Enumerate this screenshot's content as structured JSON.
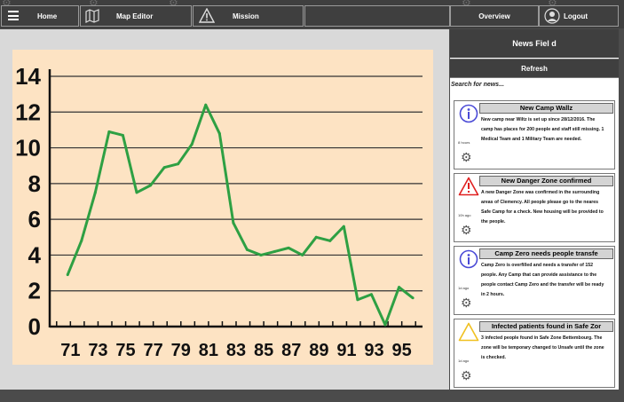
{
  "nav": {
    "menu_icon": "hamburger-icon",
    "home_label": "Home",
    "map_editor_label": "Map Editor",
    "map_icon": "map-icon",
    "mission_label": "Mission",
    "mission_icon": "warning-triangle-icon",
    "overview_label": "Overview",
    "logout_label": "Logout",
    "user_icon": "user-icon"
  },
  "sidebar": {
    "title": "News Fiel d",
    "refresh_label": "Refresh",
    "search_placeholder": "Search for news...",
    "items": [
      {
        "title": "New Camp Wallz",
        "icon": "info-icon",
        "icon_color": "#4a4ad6",
        "time": "8 hours",
        "body": "New camp near Wiltz is set up since 28/12/2016. The camp has places for 200 people and staff still missing. 1 Medical Team and 1 Military Team are needed."
      },
      {
        "title": "New Danger Zone confirmed",
        "icon": "warning-icon",
        "icon_color": "#e02020",
        "time": "10h ago",
        "body": "A new Danger Zone was confirmed in the surrounding areas of Clemency. All people please go to the neares Safe Camp for a check. New housing will be provided to the people."
      },
      {
        "title": "Camp Zero needs people transfe",
        "icon": "info-icon",
        "icon_color": "#4a4ad6",
        "time": "1d ago",
        "body": "Camp Zero is overfilled and needs a transfer of 152 people. Any Camp that can provide assistance to the people contact Camp Zero and the transfer will be ready in 2 hours."
      },
      {
        "title": "Infected patients found in Safe Zor",
        "icon": "caution-icon",
        "icon_color": "#f0c020",
        "time": "1d ago",
        "body": "3 infected people found in Safe Zone Bettembourg. The zone will be temporary changed to Unsafe until the zone is checked."
      }
    ]
  },
  "colors": {
    "chart_background": "#fde3c3",
    "line": "#2ea043",
    "panel": "#3f3f3f"
  },
  "chart_data": {
    "type": "line",
    "title": "",
    "xlabel": "",
    "ylabel": "",
    "xlim": [
      69.5,
      96.5
    ],
    "ylim": [
      0,
      14
    ],
    "y_ticks": [
      0,
      2,
      4,
      6,
      8,
      10,
      12,
      14
    ],
    "x_ticks": [
      71,
      73,
      75,
      77,
      79,
      81,
      83,
      85,
      87,
      89,
      91,
      93,
      95
    ],
    "grid": "horizontal",
    "series": [
      {
        "x": [
          70.8,
          71.8,
          72.8,
          73.8,
          74.8,
          75.8,
          76.8,
          77.8,
          78.8,
          79.8,
          80.8,
          81.8,
          82.8,
          83.8,
          84.8,
          85.8,
          86.8,
          87.8,
          88.8,
          89.8,
          90.8,
          91.8,
          92.8,
          93.8,
          94.8,
          95.8
        ],
        "y": [
          2.9,
          4.8,
          7.5,
          10.9,
          10.7,
          7.5,
          7.9,
          8.9,
          9.1,
          10.2,
          12.4,
          10.8,
          5.8,
          4.3,
          4.0,
          4.2,
          4.4,
          4.0,
          5.0,
          4.8,
          5.6,
          1.5,
          1.8,
          0.1,
          2.2,
          1.6
        ]
      }
    ]
  }
}
